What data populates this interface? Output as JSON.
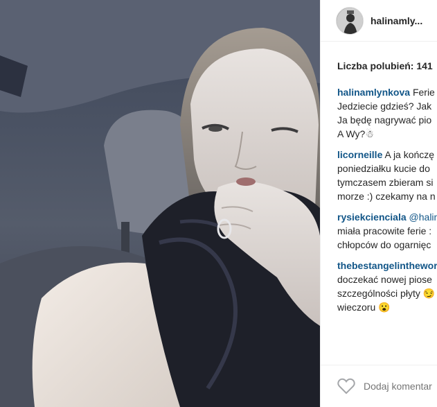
{
  "post": {
    "username": "halinamly...",
    "likes_label": "Liczba polubień: 141",
    "comments": [
      {
        "user": "halinamlynkova",
        "lines": [
          "Ferie",
          "Jedziecie gdzieś? Jak",
          "Ja będę nagrywać pio",
          "A Wy?☃"
        ]
      },
      {
        "user": "licorneille",
        "lines": [
          "A ja kończę",
          "poniedziałku kucie do",
          "tymczasem zbieram si",
          "morze :) czekamy na n"
        ]
      },
      {
        "user": "rysiekcienciala",
        "lines": [
          "@halin",
          "miała pracowite ferie :",
          "chłopców do ogarnięc"
        ]
      },
      {
        "user": "thebestangelinthewor",
        "lines": [
          "doczekać nowej piose",
          "szczególności płyty 😏",
          "wieczoru 😮"
        ]
      }
    ],
    "add_comment_placeholder": "Dodaj komentar"
  },
  "icons": {
    "like": "heart-outline-icon",
    "avatar": "profile-photo"
  },
  "colors": {
    "username": "#125688",
    "text": "#262626",
    "placeholder": "#a5a7aa"
  }
}
